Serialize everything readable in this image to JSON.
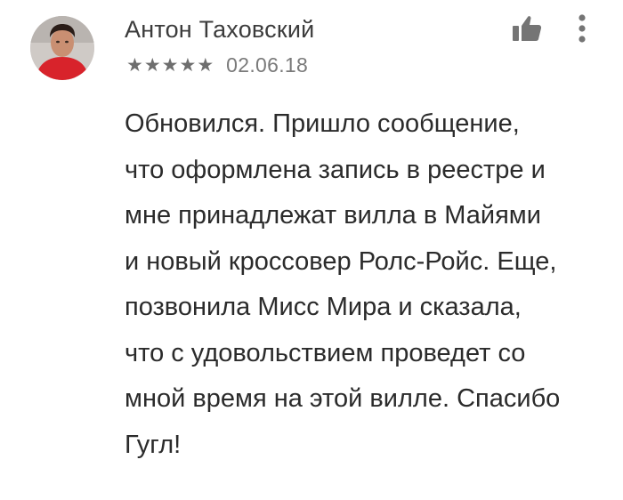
{
  "review": {
    "author": "Антон Таховский",
    "rating": 5,
    "stars": [
      "★",
      "★",
      "★",
      "★",
      "★"
    ],
    "date": "02.06.18",
    "text_lines": [
      "Обновился. Пришло сообщение,",
      "что оформлена запись в реестре и",
      "мне принадлежат вилла в Майями",
      "и новый кроссовер Ролс-Ройс. Еще,",
      "позвонила Мисс Мира и сказала,",
      "что с удовольствием проведет со",
      "мной время на этой вилле. Спасибо",
      "Гугл!"
    ]
  },
  "icons": {
    "avatar": "user-avatar",
    "like": "thumbs-up-icon",
    "menu": "more-vert-icon"
  },
  "colors": {
    "author_text": "#3c3c3c",
    "meta_text": "#7a7a7a",
    "star": "#6e6e6e",
    "body_text": "#2b2b2b",
    "icon": "#757575"
  }
}
